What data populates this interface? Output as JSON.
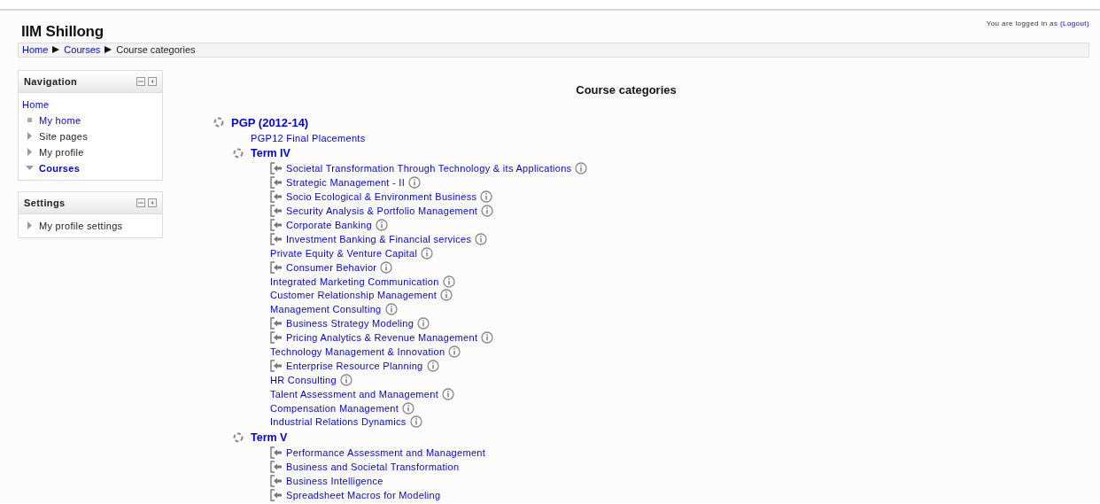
{
  "header": {
    "site_name": "IIM Shillong",
    "login_text": "You are logged in as",
    "logout": "(Logout)"
  },
  "breadcrumb": [
    {
      "label": "Home",
      "link": true
    },
    {
      "label": "Courses",
      "link": true
    },
    {
      "label": "Course categories",
      "link": false
    }
  ],
  "blocks": [
    {
      "title": "Navigation",
      "items": [
        {
          "label": "Home",
          "kind": "root",
          "link": true,
          "expanded": false
        },
        {
          "label": "My home",
          "kind": "leaf",
          "link": true,
          "expanded": false
        },
        {
          "label": "Site pages",
          "kind": "branch",
          "link": false,
          "expanded": false
        },
        {
          "label": "My profile",
          "kind": "branch",
          "link": false,
          "expanded": false
        },
        {
          "label": "Courses",
          "kind": "branch",
          "link": true,
          "expanded": true
        }
      ]
    },
    {
      "title": "Settings",
      "items": [
        {
          "label": "My profile settings",
          "kind": "branch",
          "link": false,
          "expanded": false
        }
      ]
    }
  ],
  "main": {
    "title": "Course categories",
    "category": {
      "name": "PGP (2012-14)",
      "courses": [
        {
          "name": "PGP12 Final Placements",
          "kind": "plain",
          "info": false
        }
      ],
      "children": [
        {
          "name": "Term IV",
          "courses": [
            {
              "name": "Societal Transformation Through Technology & its Applications",
              "kind": "enrol",
              "info": true
            },
            {
              "name": "Strategic Management - II",
              "kind": "enrol",
              "info": true
            },
            {
              "name": "Socio Ecological & Environment Business",
              "kind": "enrol",
              "info": true
            },
            {
              "name": "Security Analysis & Portfolio Management",
              "kind": "enrol",
              "info": true
            },
            {
              "name": "Corporate Banking",
              "kind": "enrol",
              "info": true
            },
            {
              "name": "Investment Banking & Financial services",
              "kind": "enrol",
              "info": true
            },
            {
              "name": "Private Equity & Venture Capital",
              "kind": "plain",
              "info": true
            },
            {
              "name": "Consumer Behavior",
              "kind": "enrol",
              "info": true
            },
            {
              "name": "Integrated Marketing Communication",
              "kind": "plain",
              "info": true
            },
            {
              "name": "Customer Relationship Management",
              "kind": "plain",
              "info": true
            },
            {
              "name": "Management Consulting",
              "kind": "plain",
              "info": true
            },
            {
              "name": "Business Strategy Modeling",
              "kind": "enrol",
              "info": true
            },
            {
              "name": "Pricing Analytics & Revenue Management",
              "kind": "enrol",
              "info": true
            },
            {
              "name": "Technology Management & Innovation",
              "kind": "plain",
              "info": true
            },
            {
              "name": "Enterprise Resource Planning",
              "kind": "enrol",
              "info": true
            },
            {
              "name": "HR Consulting",
              "kind": "plain",
              "info": true
            },
            {
              "name": "Talent Assessment and Management",
              "kind": "plain",
              "info": true
            },
            {
              "name": "Compensation Management",
              "kind": "plain",
              "info": true
            },
            {
              "name": "Industrial Relations Dynamics",
              "kind": "plain",
              "info": true
            }
          ]
        },
        {
          "name": "Term V",
          "courses": [
            {
              "name": "Performance Assessment and Management",
              "kind": "enrol",
              "info": false
            },
            {
              "name": "Business and Societal Transformation",
              "kind": "enrol",
              "info": false
            },
            {
              "name": "Business Intelligence",
              "kind": "enrol",
              "info": false
            },
            {
              "name": "Spreadsheet Macros for Modeling",
              "kind": "enrol",
              "info": false
            }
          ]
        }
      ]
    }
  }
}
